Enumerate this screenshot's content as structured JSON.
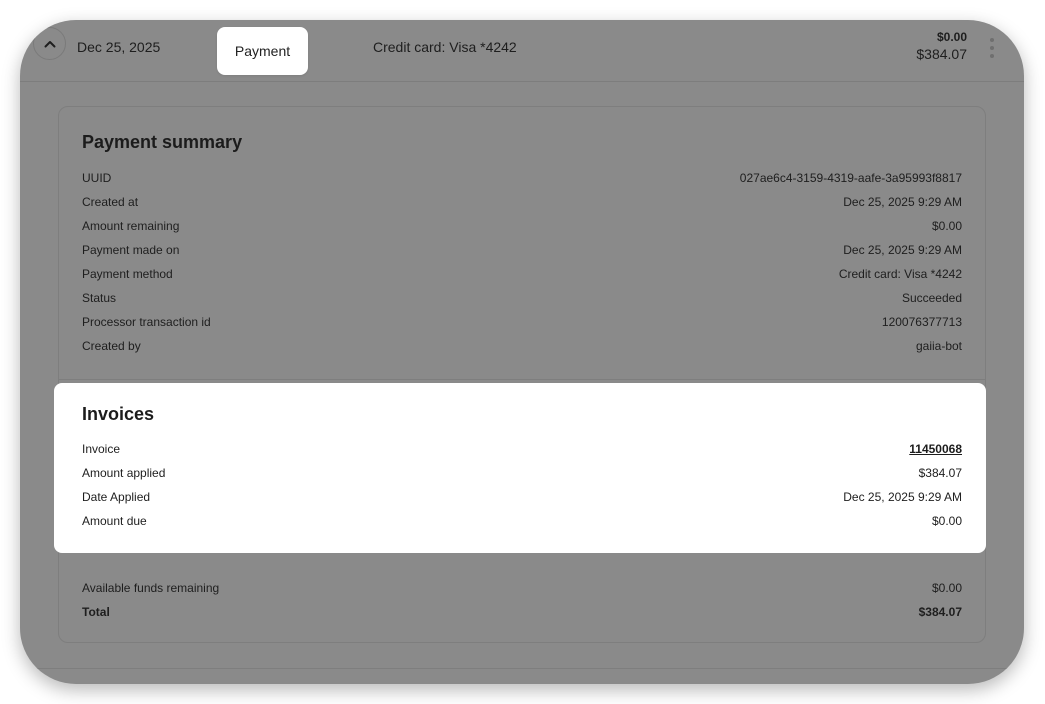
{
  "header": {
    "date": "Dec 25, 2025",
    "type": "Payment",
    "method": "Credit card: Visa *4242",
    "amount_remaining": "$0.00",
    "amount_total": "$384.07"
  },
  "summary": {
    "title": "Payment summary",
    "rows": [
      {
        "label": "UUID",
        "value": "027ae6c4-3159-4319-aafe-3a95993f8817"
      },
      {
        "label": "Created at",
        "value": "Dec 25, 2025 9:29 AM"
      },
      {
        "label": "Amount remaining",
        "value": "$0.00"
      },
      {
        "label": "Payment made on",
        "value": "Dec 25, 2025 9:29 AM"
      },
      {
        "label": "Payment method",
        "value": "Credit card: Visa *4242"
      },
      {
        "label": "Status",
        "value": "Succeeded"
      },
      {
        "label": "Processor transaction id",
        "value": "120076377713"
      },
      {
        "label": "Created by",
        "value": "gaiia-bot"
      }
    ]
  },
  "invoices": {
    "title": "Invoices",
    "rows": [
      {
        "label": "Invoice",
        "value": "11450068"
      },
      {
        "label": "Amount applied",
        "value": "$384.07"
      },
      {
        "label": "Date Applied",
        "value": "Dec 25, 2025 9:29 AM"
      },
      {
        "label": "Amount due",
        "value": "$0.00"
      }
    ]
  },
  "totals": {
    "available_label": "Available funds remaining",
    "available_value": "$0.00",
    "total_label": "Total",
    "total_value": "$384.07"
  },
  "icons": {
    "collapse": "chevron-up-icon",
    "menu": "kebab-menu-icon"
  }
}
